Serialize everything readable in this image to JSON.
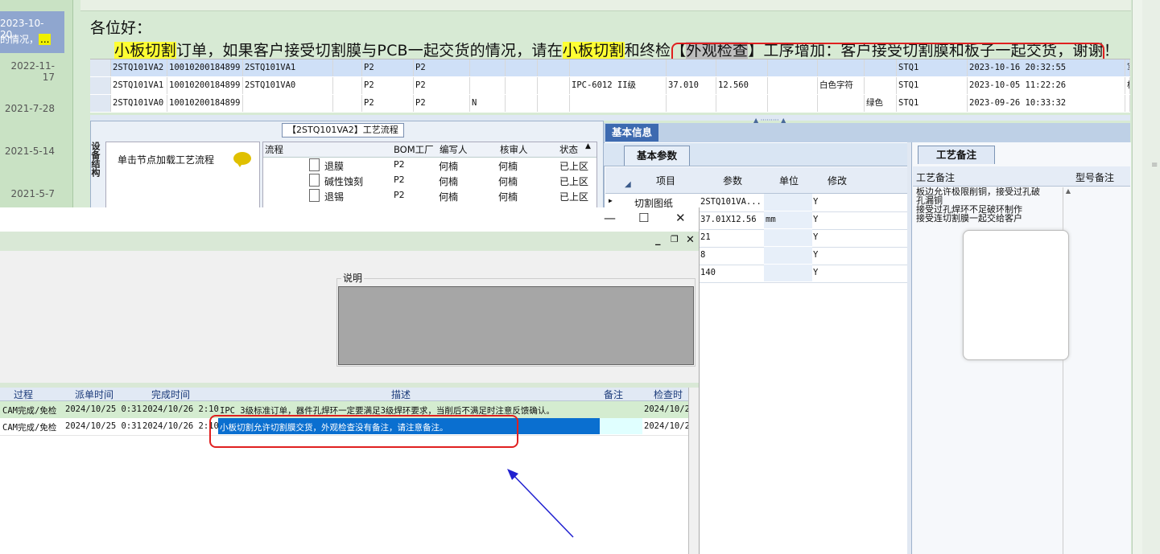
{
  "left_strip": {
    "selected_date": "2023-10-20",
    "selected_text": "的情况，",
    "selected_text_ellipsis": "...",
    "dates": [
      "2022-11-17",
      "2021-7-28",
      "2021-5-14",
      "2021-5-7"
    ]
  },
  "notice": {
    "greeting": "各位好：",
    "seg1": "小板切割",
    "seg2": "订单，如果客户接受切割膜与PCB一起交货的情况，请在",
    "seg3": "小板切割",
    "seg4": "和终检【",
    "seg5": "外观检查",
    "seg6": "】工序增加：客户接受切割膜和板子一起交货，谢谢！"
  },
  "top_grid": {
    "rows": [
      {
        "a": "2STQ101VA2",
        "b": "10010200184899",
        "c": "2STQ101VA1",
        "d": "P2",
        "e": "P2",
        "f": "",
        "g": "",
        "h": "",
        "i": "",
        "j": "",
        "k": "",
        "l": "STQ1",
        "m": "2023-10-16 20:32:55",
        "n": "军"
      },
      {
        "a": "2STQ101VA1",
        "b": "10010200184899",
        "c": "2STQ101VA0",
        "d": "P2",
        "e": "P2",
        "f": "",
        "g": "IPC-6012 II级",
        "h": "37.010",
        "i": "12.560",
        "j": "白色字符",
        "k": "",
        "l": "STQ1",
        "m": "2023-10-05 11:22:26",
        "n": "杨"
      },
      {
        "a": "2STQ101VA0",
        "b": "10010200184899",
        "c": "",
        "d": "P2",
        "e": "P2",
        "f": "N",
        "g": "",
        "h": "",
        "i": "",
        "j": "",
        "k": "绿色",
        "l": "STQ1",
        "m": "2023-09-26 10:33:32",
        "n": ""
      }
    ]
  },
  "process": {
    "title": "【2STQ101VA2】工艺流程",
    "side_label": "设备结构",
    "hint": "单击节点加载工艺流程",
    "headers": [
      "流程",
      "BOM工厂",
      "编写人",
      "核审人",
      "状态"
    ],
    "rows": [
      {
        "name": "退膜",
        "bom": "P2",
        "writer": "何楠",
        "reviewer": "何楠",
        "status": "已上区"
      },
      {
        "name": "碱性蚀刻",
        "bom": "P2",
        "writer": "何楠",
        "reviewer": "何楠",
        "status": "已上区"
      },
      {
        "name": "退锡",
        "bom": "P2",
        "writer": "何楠",
        "reviewer": "何楠",
        "status": "已上区"
      }
    ]
  },
  "info": {
    "tab": "基本信息",
    "param_tab": "基本参数",
    "headers": [
      "项目",
      "参数",
      "单位",
      "修改"
    ],
    "rows": [
      {
        "item": "切割图纸",
        "param": "2STQ101VA...",
        "unit": "",
        "edit": "Y"
      },
      {
        "item": "",
        "param": "37.01X12.56",
        "unit": "mm",
        "edit": "Y"
      },
      {
        "item": "",
        "param": "21",
        "unit": "",
        "edit": "Y"
      },
      {
        "item": "",
        "param": "8",
        "unit": "",
        "edit": "Y"
      },
      {
        "item": "",
        "param": "140",
        "unit": "",
        "edit": "Y"
      }
    ]
  },
  "craft": {
    "tab": "工艺备注",
    "col1": "工艺备注",
    "col2": "型号备注",
    "lines": [
      "板边允许极限削铜，接受过孔破",
      "孔漏铜",
      "接受过孔焊环不足破环制作",
      "接受连切割膜一起交给客户"
    ]
  },
  "dialog": {
    "desc_label": "说明",
    "log_headers": [
      "过程",
      "派单时间",
      "完成时间",
      "描述",
      "备注",
      "检查时间"
    ],
    "log_rows": [
      {
        "proc": "CAM完成/免检",
        "dispatch": "2024/10/25 0:31",
        "done": "2024/10/26 2:10",
        "desc": "IPC 3级标准订单，器件孔焊环一定要满足3级焊环要求，当削后不满足时注意反馈确认。",
        "note": "",
        "check": "2024/10/2"
      },
      {
        "proc": "CAM完成/免检",
        "dispatch": "2024/10/25 0:31",
        "done": "2024/10/26 2:10",
        "desc": "小板切割允许切割膜交货，外观检查没有备注，请注意备注。",
        "note": "",
        "check": "2024/10/2"
      }
    ]
  },
  "colors": {
    "highlight": "#ffff33",
    "selection": "#0a6fd0",
    "red_annotation": "#e02020",
    "arrow": "#2020d0"
  }
}
